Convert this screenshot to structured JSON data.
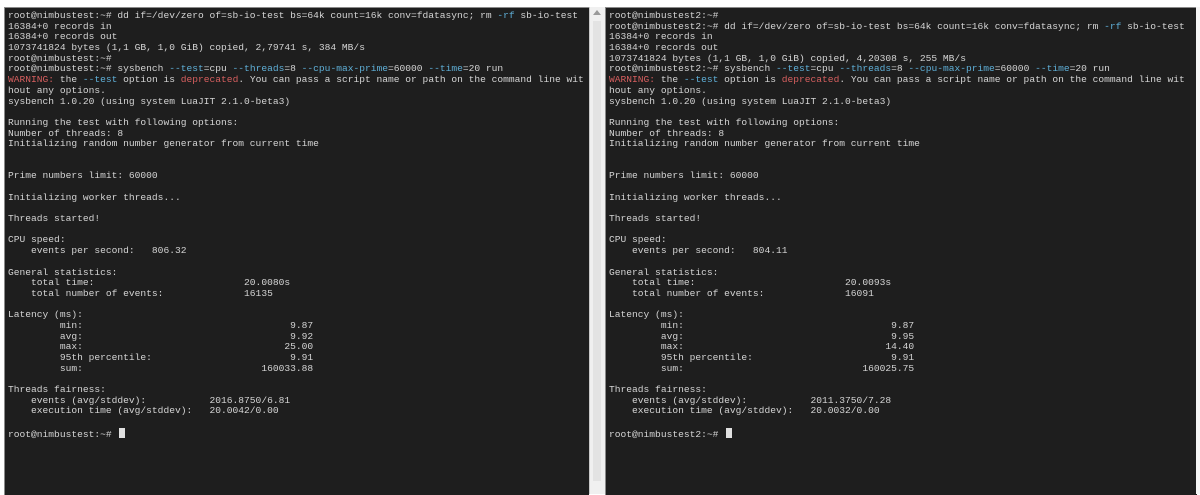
{
  "panes": {
    "left": {
      "lines": [
        [
          {
            "t": "root@nimbustest:~# dd if=/dev/zero of=sb-io-test bs=64k count=16k conv=fdatasync; rm ",
            "c": ""
          },
          {
            "t": "-rf",
            "c": "opt"
          },
          {
            "t": " sb-io-test",
            "c": ""
          }
        ],
        [
          {
            "t": "16384+0 records in",
            "c": ""
          }
        ],
        [
          {
            "t": "16384+0 records out",
            "c": ""
          }
        ],
        [
          {
            "t": "1073741824 bytes (1,1 GB, 1,0 GiB) copied, 2,79741 s, 384 MB/s",
            "c": ""
          }
        ],
        [
          {
            "t": "root@nimbustest:~#",
            "c": ""
          }
        ],
        [
          {
            "t": "root@nimbustest:~# sysbench ",
            "c": ""
          },
          {
            "t": "--test",
            "c": "opt"
          },
          {
            "t": "=cpu ",
            "c": ""
          },
          {
            "t": "--threads",
            "c": "opt"
          },
          {
            "t": "=8 ",
            "c": ""
          },
          {
            "t": "--cpu-max-prime",
            "c": "opt"
          },
          {
            "t": "=60000 ",
            "c": ""
          },
          {
            "t": "--time",
            "c": "opt"
          },
          {
            "t": "=20 run",
            "c": ""
          }
        ],
        [
          {
            "t": "WARNING:",
            "c": "warn"
          },
          {
            "t": " the ",
            "c": ""
          },
          {
            "t": "--test",
            "c": "opt"
          },
          {
            "t": " option is ",
            "c": ""
          },
          {
            "t": "deprecated",
            "c": "warn"
          },
          {
            "t": ". You can pass a script name or path on the command line wit",
            "c": ""
          }
        ],
        [
          {
            "t": "hout any options.",
            "c": ""
          }
        ],
        [
          {
            "t": "sysbench 1.0.20 (using system LuaJIT 2.1.0-beta3)",
            "c": ""
          }
        ],
        [
          {
            "t": "",
            "c": ""
          }
        ],
        [
          {
            "t": "Running the test with following options:",
            "c": ""
          }
        ],
        [
          {
            "t": "Number of threads: 8",
            "c": ""
          }
        ],
        [
          {
            "t": "Initializing random number generator from current time",
            "c": ""
          }
        ],
        [
          {
            "t": "",
            "c": ""
          }
        ],
        [
          {
            "t": "",
            "c": ""
          }
        ],
        [
          {
            "t": "Prime numbers limit: 60000",
            "c": ""
          }
        ],
        [
          {
            "t": "",
            "c": ""
          }
        ],
        [
          {
            "t": "Initializing worker threads...",
            "c": ""
          }
        ],
        [
          {
            "t": "",
            "c": ""
          }
        ],
        [
          {
            "t": "Threads started!",
            "c": ""
          }
        ],
        [
          {
            "t": "",
            "c": ""
          }
        ],
        [
          {
            "t": "CPU speed:",
            "c": ""
          }
        ],
        [
          {
            "t": "    events per second:   806.32",
            "c": ""
          }
        ],
        [
          {
            "t": "",
            "c": ""
          }
        ],
        [
          {
            "t": "General statistics:",
            "c": ""
          }
        ],
        [
          {
            "t": "    total time:                          20.0080s",
            "c": ""
          }
        ],
        [
          {
            "t": "    total number of events:              16135",
            "c": ""
          }
        ],
        [
          {
            "t": "",
            "c": ""
          }
        ],
        [
          {
            "t": "Latency (ms):",
            "c": ""
          }
        ],
        [
          {
            "t": "         min:                                    9.87",
            "c": ""
          }
        ],
        [
          {
            "t": "         avg:                                    9.92",
            "c": ""
          }
        ],
        [
          {
            "t": "         max:                                   25.00",
            "c": ""
          }
        ],
        [
          {
            "t": "         95th percentile:                        9.91",
            "c": ""
          }
        ],
        [
          {
            "t": "         sum:                               160033.88",
            "c": ""
          }
        ],
        [
          {
            "t": "",
            "c": ""
          }
        ],
        [
          {
            "t": "Threads fairness:",
            "c": ""
          }
        ],
        [
          {
            "t": "    events (avg/stddev):           2016.8750/6.81",
            "c": ""
          }
        ],
        [
          {
            "t": "    execution time (avg/stddev):   20.0042/0.00",
            "c": ""
          }
        ],
        [
          {
            "t": "",
            "c": ""
          }
        ],
        [
          {
            "t": "root@nimbustest:~# ",
            "c": "prompt"
          }
        ]
      ]
    },
    "right": {
      "lines": [
        [
          {
            "t": "root@nimbustest2:~#",
            "c": ""
          }
        ],
        [
          {
            "t": "root@nimbustest2:~# dd if=/dev/zero of=sb-io-test bs=64k count=16k conv=fdatasync; rm ",
            "c": ""
          },
          {
            "t": "-rf",
            "c": "opt"
          },
          {
            "t": " sb-io-test",
            "c": ""
          }
        ],
        [
          {
            "t": "16384+0 records in",
            "c": ""
          }
        ],
        [
          {
            "t": "16384+0 records out",
            "c": ""
          }
        ],
        [
          {
            "t": "1073741824 bytes (1,1 GB, 1,0 GiB) copied, 4,20308 s, 255 MB/s",
            "c": ""
          }
        ],
        [
          {
            "t": "root@nimbustest2:~# sysbench ",
            "c": ""
          },
          {
            "t": "--test",
            "c": "opt"
          },
          {
            "t": "=cpu ",
            "c": ""
          },
          {
            "t": "--threads",
            "c": "opt"
          },
          {
            "t": "=8 ",
            "c": ""
          },
          {
            "t": "--cpu-max-prime",
            "c": "opt"
          },
          {
            "t": "=60000 ",
            "c": ""
          },
          {
            "t": "--time",
            "c": "opt"
          },
          {
            "t": "=20 run",
            "c": ""
          }
        ],
        [
          {
            "t": "WARNING:",
            "c": "warn"
          },
          {
            "t": " the ",
            "c": ""
          },
          {
            "t": "--test",
            "c": "opt"
          },
          {
            "t": " option is ",
            "c": ""
          },
          {
            "t": "deprecated",
            "c": "warn"
          },
          {
            "t": ". You can pass a script name or path on the command line wit",
            "c": ""
          }
        ],
        [
          {
            "t": "hout any options.",
            "c": ""
          }
        ],
        [
          {
            "t": "sysbench 1.0.20 (using system LuaJIT 2.1.0-beta3)",
            "c": ""
          }
        ],
        [
          {
            "t": "",
            "c": ""
          }
        ],
        [
          {
            "t": "Running the test with following options:",
            "c": ""
          }
        ],
        [
          {
            "t": "Number of threads: 8",
            "c": ""
          }
        ],
        [
          {
            "t": "Initializing random number generator from current time",
            "c": ""
          }
        ],
        [
          {
            "t": "",
            "c": ""
          }
        ],
        [
          {
            "t": "",
            "c": ""
          }
        ],
        [
          {
            "t": "Prime numbers limit: 60000",
            "c": ""
          }
        ],
        [
          {
            "t": "",
            "c": ""
          }
        ],
        [
          {
            "t": "Initializing worker threads...",
            "c": ""
          }
        ],
        [
          {
            "t": "",
            "c": ""
          }
        ],
        [
          {
            "t": "Threads started!",
            "c": ""
          }
        ],
        [
          {
            "t": "",
            "c": ""
          }
        ],
        [
          {
            "t": "CPU speed:",
            "c": ""
          }
        ],
        [
          {
            "t": "    events per second:   804.11",
            "c": ""
          }
        ],
        [
          {
            "t": "",
            "c": ""
          }
        ],
        [
          {
            "t": "General statistics:",
            "c": ""
          }
        ],
        [
          {
            "t": "    total time:                          20.0093s",
            "c": ""
          }
        ],
        [
          {
            "t": "    total number of events:              16091",
            "c": ""
          }
        ],
        [
          {
            "t": "",
            "c": ""
          }
        ],
        [
          {
            "t": "Latency (ms):",
            "c": ""
          }
        ],
        [
          {
            "t": "         min:                                    9.87",
            "c": ""
          }
        ],
        [
          {
            "t": "         avg:                                    9.95",
            "c": ""
          }
        ],
        [
          {
            "t": "         max:                                   14.40",
            "c": ""
          }
        ],
        [
          {
            "t": "         95th percentile:                        9.91",
            "c": ""
          }
        ],
        [
          {
            "t": "         sum:                               160025.75",
            "c": ""
          }
        ],
        [
          {
            "t": "",
            "c": ""
          }
        ],
        [
          {
            "t": "Threads fairness:",
            "c": ""
          }
        ],
        [
          {
            "t": "    events (avg/stddev):           2011.3750/7.28",
            "c": ""
          }
        ],
        [
          {
            "t": "    execution time (avg/stddev):   20.0032/0.00",
            "c": ""
          }
        ],
        [
          {
            "t": "",
            "c": ""
          }
        ],
        [
          {
            "t": "root@nimbustest2:~# ",
            "c": "prompt"
          }
        ]
      ]
    }
  },
  "colors": {
    "background": "#1e1e1e",
    "text": "#d4d4d4",
    "option": "#5fafd7",
    "warning": "#d75f5f"
  }
}
